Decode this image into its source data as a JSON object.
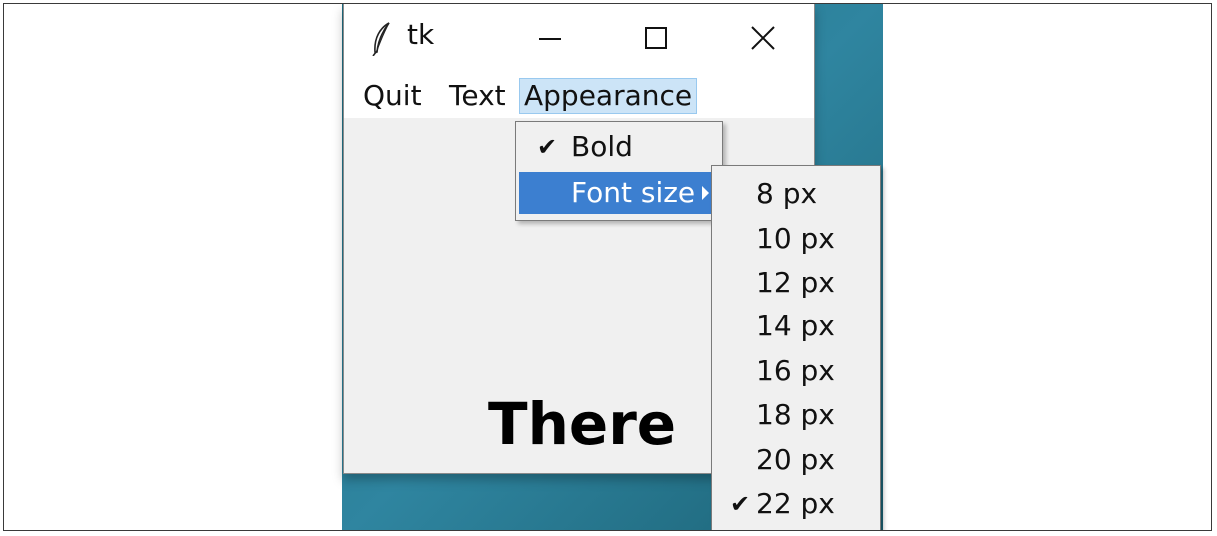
{
  "window": {
    "title": "tk",
    "controls": {
      "minimize": "minimize-icon",
      "maximize": "maximize-icon",
      "close": "close-icon"
    }
  },
  "menubar": {
    "items": [
      {
        "label": "Quit",
        "active": false
      },
      {
        "label": "Text",
        "active": false
      },
      {
        "label": "Appearance",
        "active": true
      }
    ]
  },
  "appearance_menu": {
    "items": [
      {
        "label": "Bold",
        "checked": true,
        "check": "✔"
      },
      {
        "label": "Font size",
        "submenu": true,
        "highlighted": true
      }
    ]
  },
  "font_size_menu": {
    "items": [
      {
        "label": "8 px",
        "checked": false,
        "check": ""
      },
      {
        "label": "10 px",
        "checked": false,
        "check": ""
      },
      {
        "label": "12 px",
        "checked": false,
        "check": ""
      },
      {
        "label": "14 px",
        "checked": false,
        "check": ""
      },
      {
        "label": "16 px",
        "checked": false,
        "check": ""
      },
      {
        "label": "18 px",
        "checked": false,
        "check": ""
      },
      {
        "label": "20 px",
        "checked": false,
        "check": ""
      },
      {
        "label": "22 px",
        "checked": true,
        "check": "✔"
      }
    ]
  },
  "content": {
    "text": "There"
  },
  "colors": {
    "highlight": "#3c7fd0",
    "menubar_active": "#cce4f7",
    "desktop": "#2f85a0",
    "window_bg": "#f0f0f0"
  }
}
